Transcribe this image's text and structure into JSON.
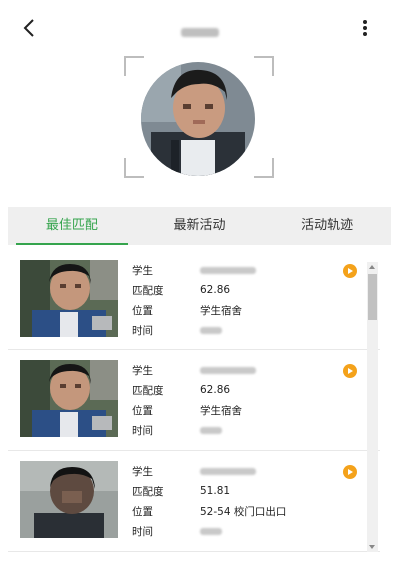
{
  "header": {
    "back_icon": "chevron-left-icon",
    "title": "",
    "more_icon": "more-vertical-icon"
  },
  "tabs": [
    {
      "label": "最佳匹配",
      "active": true
    },
    {
      "label": "最新活动",
      "active": false
    },
    {
      "label": "活动轨迹",
      "active": false
    }
  ],
  "colors": {
    "accent": "#35a44d",
    "play": "#f4a21b",
    "tab_bg": "#efefef"
  },
  "records": [
    {
      "student_label": "学生",
      "student_value": "",
      "match_label": "匹配度",
      "match_value": "62.86",
      "location_label": "位置",
      "location_value": "学生宿舍",
      "time_label": "时间",
      "time_value": ""
    },
    {
      "student_label": "学生",
      "student_value": "",
      "match_label": "匹配度",
      "match_value": "62.86",
      "location_label": "位置",
      "location_value": "学生宿舍",
      "time_label": "时间",
      "time_value": ""
    },
    {
      "student_label": "学生",
      "student_value": "",
      "match_label": "匹配度",
      "match_value": "51.81",
      "location_label": "位置",
      "location_value": "52-54 校门口出口",
      "time_label": "时间",
      "time_value": ""
    }
  ]
}
